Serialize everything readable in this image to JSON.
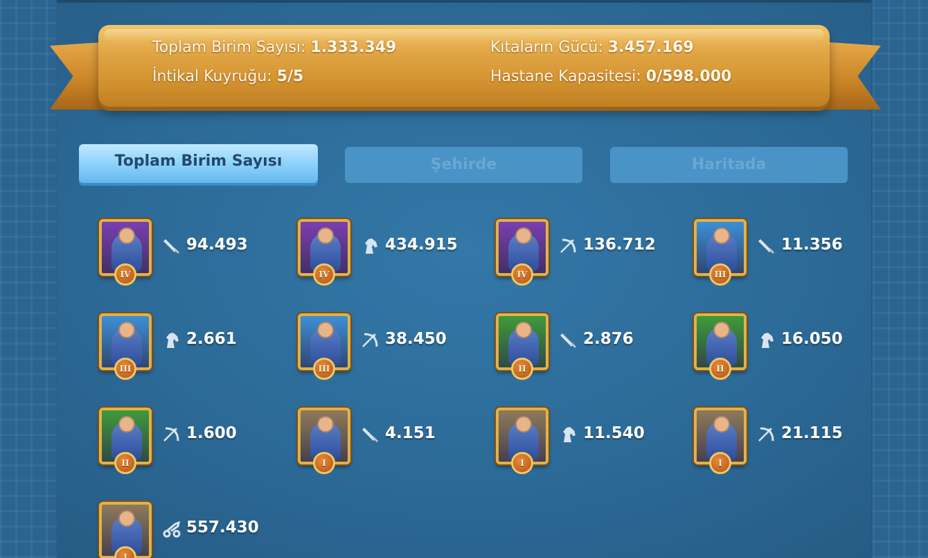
{
  "header": {
    "total_units_label": "Toplam Birim Sayısı:",
    "total_units_value": "1.333.349",
    "march_queue_label": "İntikal Kuyruğu:",
    "march_queue_value": "5/5",
    "power_label": "Kıtaların Gücü:",
    "power_value": "3.457.169",
    "hospital_label": "Hastane Kapasitesi:",
    "hospital_value": "0/598.000"
  },
  "tabs": [
    {
      "label": "Toplam Birim Sayısı",
      "active": true
    },
    {
      "label": "Şehirde",
      "active": false
    },
    {
      "label": "Haritada",
      "active": false
    }
  ],
  "units": [
    {
      "type": "infantry-icon",
      "tier": "IV",
      "count": "94.493",
      "bg": "#7a3fb0"
    },
    {
      "type": "cavalry-icon",
      "tier": "IV",
      "count": "434.915",
      "bg": "#7a3fb0"
    },
    {
      "type": "archer-icon",
      "tier": "IV",
      "count": "136.712",
      "bg": "#7a3fb0"
    },
    {
      "type": "infantry-icon",
      "tier": "III",
      "count": "11.356",
      "bg": "#3d8fd6"
    },
    {
      "type": "cavalry-icon",
      "tier": "III",
      "count": "2.661",
      "bg": "#3d8fd6"
    },
    {
      "type": "archer-icon",
      "tier": "III",
      "count": "38.450",
      "bg": "#3d8fd6"
    },
    {
      "type": "infantry-icon",
      "tier": "II",
      "count": "2.876",
      "bg": "#3f9a3a"
    },
    {
      "type": "cavalry-icon",
      "tier": "II",
      "count": "16.050",
      "bg": "#3f9a3a"
    },
    {
      "type": "archer-icon",
      "tier": "II",
      "count": "1.600",
      "bg": "#3f9a3a"
    },
    {
      "type": "infantry-icon",
      "tier": "I",
      "count": "4.151",
      "bg": "#8e7a5a"
    },
    {
      "type": "cavalry-icon",
      "tier": "I",
      "count": "11.540",
      "bg": "#8e7a5a"
    },
    {
      "type": "archer-icon",
      "tier": "I",
      "count": "21.115",
      "bg": "#8e7a5a"
    },
    {
      "type": "siege-icon",
      "tier": "I",
      "count": "557.430",
      "bg": "#8e7a5a"
    }
  ]
}
